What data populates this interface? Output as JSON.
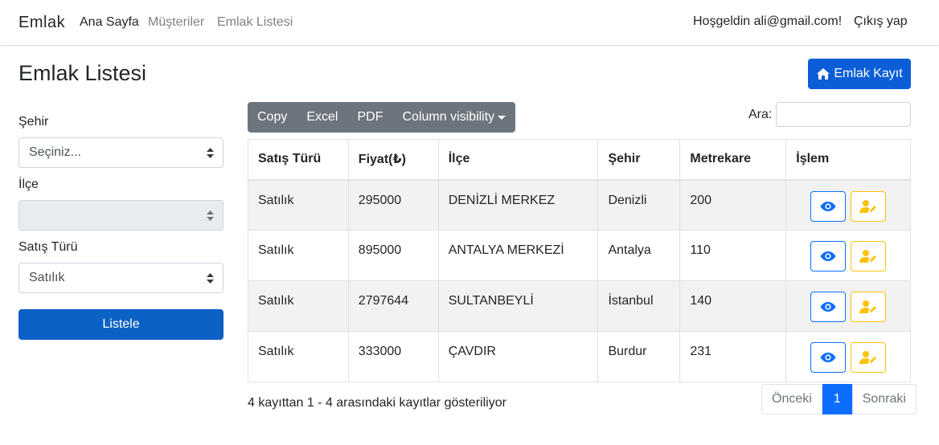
{
  "nav": {
    "brand": "Emlak",
    "links": [
      "Ana Sayfa",
      "Müşteriler",
      "Emlak Listesi"
    ],
    "greeting": "Hoşgeldin ali@gmail.com!",
    "logout": "Çıkış yap"
  },
  "page": {
    "title": "Emlak Listesi",
    "add_button": "Emlak Kayıt"
  },
  "filters": {
    "city_label": "Şehir",
    "city_value": "Seçiniz...",
    "district_label": "İlçe",
    "district_value": "",
    "sale_type_label": "Satış Türü",
    "sale_type_value": "Satılık",
    "submit": "Listele"
  },
  "toolbar": {
    "buttons": [
      "Copy",
      "Excel",
      "PDF",
      "Column visibility"
    ],
    "search_label": "Ara:",
    "search_value": ""
  },
  "table": {
    "headers": [
      "Satış Türü",
      "Fiyat(₺)",
      "İlçe",
      "Şehir",
      "Metrekare",
      "İşlem"
    ],
    "rows": [
      [
        "Satılık",
        "295000",
        "DENİZLİ MERKEZ",
        "Denizli",
        "200"
      ],
      [
        "Satılık",
        "895000",
        "ANTALYA MERKEZİ",
        "Antalya",
        "110"
      ],
      [
        "Satılık",
        "2797644",
        "SULTANBEYLİ",
        "İstanbul",
        "140"
      ],
      [
        "Satılık",
        "333000",
        "ÇAVDIR",
        "Burdur",
        "231"
      ]
    ]
  },
  "footer": {
    "info": "4 kayıttan 1 - 4 arasındaki kayıtlar gösteriliyor",
    "prev": "Önceki",
    "page": "1",
    "next": "Sonraki"
  },
  "colors": {
    "primary": "#0d6efd",
    "warning": "#ffc107",
    "secondary": "#6c757d"
  }
}
